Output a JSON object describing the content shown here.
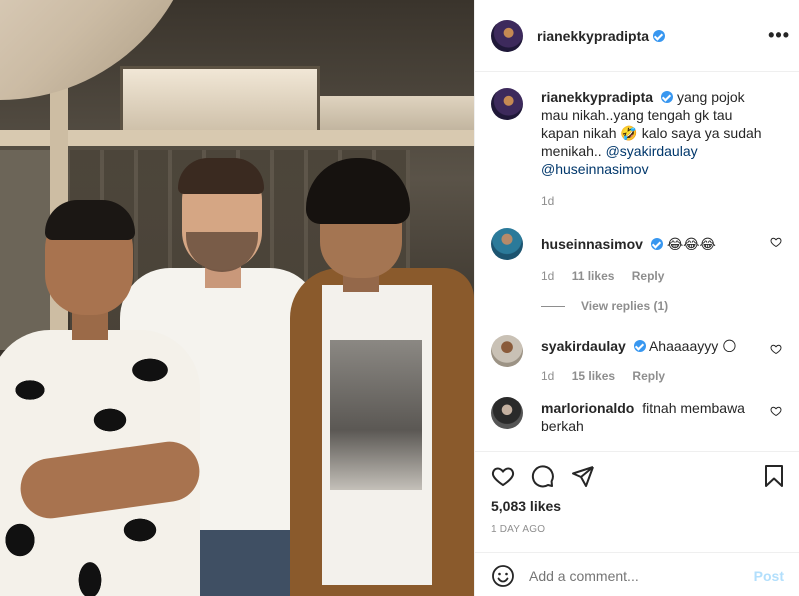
{
  "header": {
    "username": "rianekkypradipta",
    "more_label": "•••"
  },
  "caption": {
    "username": "rianekkypradipta",
    "text": "yang pojok mau nikah..yang tengah gk tau kapan nikah 🤣 kalo saya ya sudah menikah..",
    "mention1": "@syakirdaulay",
    "mention2": "@huseinnasimov",
    "time": "1d"
  },
  "comments": [
    {
      "username": "huseinnasimov",
      "text": "😂😂😂",
      "time": "1d",
      "likes": "11 likes",
      "reply": "Reply",
      "view_replies": "View replies (1)"
    },
    {
      "username": "syakirdaulay",
      "text": "Ahaaaayyy 🌕",
      "time": "1d",
      "likes": "15 likes",
      "reply": "Reply"
    },
    {
      "username": "marlorionaldo",
      "text": "fitnah membawa berkah"
    }
  ],
  "actions": {
    "likes": "5,083 likes",
    "date": "1 DAY AGO"
  },
  "add_comment": {
    "placeholder": "Add a comment...",
    "post_label": "Post"
  },
  "colors": {
    "verified": "#3897f0",
    "mention": "#00376b",
    "post_button": "#b2dffc",
    "meta": "#8e8e8e"
  },
  "icons": [
    "verified-badge-icon",
    "more-icon",
    "heart-icon",
    "comment-icon",
    "share-icon",
    "bookmark-icon",
    "emoji-icon"
  ]
}
